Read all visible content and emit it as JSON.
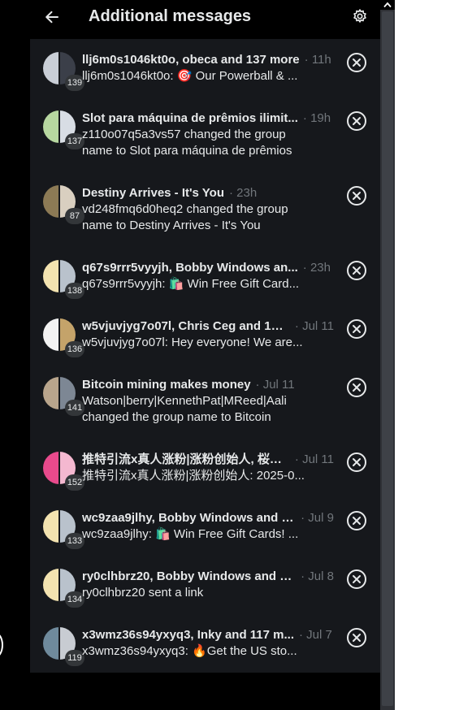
{
  "header": {
    "title": "Additional messages",
    "back_icon": "arrow-left-icon",
    "settings_icon": "gear-icon"
  },
  "colors": {
    "background": "#000000",
    "list_background": "#16181c",
    "primary_text": "#e7e9ea",
    "secondary_text": "#71767b",
    "badge": "#333639"
  },
  "conversations": [
    {
      "name": "llj6m0s1046kt0o, obeca and 137 more",
      "time": "· 11h",
      "preview": "llj6m0s1046kt0o: 🎯 Our Powerball & ...",
      "count": "139"
    },
    {
      "name": "Slot para máquina de prêmios ilimit...",
      "time": "· 19h",
      "preview": "z110o07q5a3vs57 changed the group name to Slot para máquina de prêmios",
      "count": "137"
    },
    {
      "name": "Destiny Arrives - It's You",
      "time": "· 23h",
      "preview": "vd248fmq6d0heq2 changed the group name to Destiny Arrives - It's You",
      "count": "87"
    },
    {
      "name": "q67s9rrr5vyyjh, Bobby Windows an...",
      "time": "· 23h",
      "preview": "q67s9rrr5vyyjh: 🛍️ Win Free Gift Card...",
      "count": "138"
    },
    {
      "name": "w5vjuvjyg7o07l, Chris Ceg and 134...",
      "time": "· Jul 11",
      "preview": "w5vjuvjyg7o07l: Hey everyone! We are...",
      "count": "136"
    },
    {
      "name": "Bitcoin mining makes money",
      "time": "· Jul 11",
      "preview": "Watson|berry|KennethPat|MReed|Aali changed the group name to Bitcoin",
      "count": "141"
    },
    {
      "name": "推特引流x真人涨粉|涨粉创始人, 桜@...",
      "time": "· Jul 11",
      "preview": "推特引流x真人涨粉|涨粉创始人: 2025-0...",
      "count": "152"
    },
    {
      "name": "wc9zaa9jlhy, Bobby Windows and 1...",
      "time": "· Jul 9",
      "preview": "wc9zaa9jlhy: 🛍️ Win Free Gift Cards! ...",
      "count": "133"
    },
    {
      "name": "ry0clhbrz20, Bobby Windows and 1...",
      "time": "· Jul 8",
      "preview": "ry0clhbrz20 sent a link",
      "count": "134"
    },
    {
      "name": "x3wmz36s94yxyq3, Inky and 117 m...",
      "time": "· Jul 7",
      "preview": "x3wmz36s94yxyq3: 🔥Get the US sto...",
      "count": "119"
    }
  ]
}
